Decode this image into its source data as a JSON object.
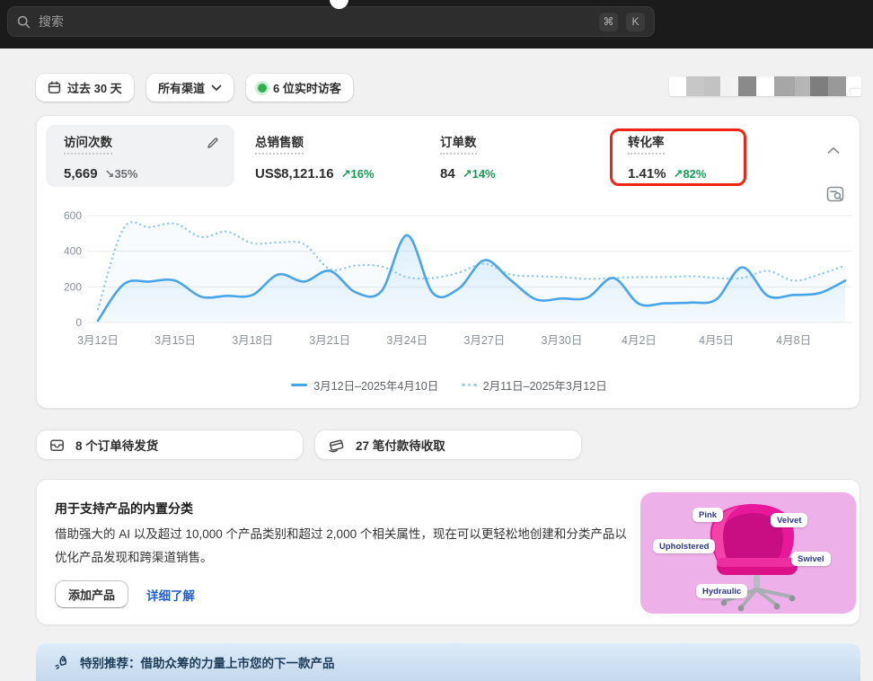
{
  "topbar": {
    "search_placeholder": "搜索",
    "shortcut_cmd": "⌘",
    "shortcut_k": "K"
  },
  "filters": {
    "date_range": "过去 30 天",
    "channel": "所有渠道",
    "live_visitors": "6 位实时访客"
  },
  "metrics": [
    {
      "label": "访问次数",
      "value": "5,669",
      "arrow": "↘",
      "delta": "35%"
    },
    {
      "label": "总销售额",
      "value": "US$8,121.16",
      "arrow": "↗",
      "delta": "16%"
    },
    {
      "label": "订单数",
      "value": "84",
      "arrow": "↗",
      "delta": "14%"
    },
    {
      "label": "转化率",
      "value": "1.41%",
      "arrow": "↗",
      "delta": "82%"
    }
  ],
  "chart_data": {
    "type": "line",
    "title": "",
    "xlabel": "",
    "ylabel": "",
    "ylim": [
      0,
      600
    ],
    "yticks": [
      0,
      200,
      400,
      600
    ],
    "grid": true,
    "legend_position": "bottom",
    "xticklabels": [
      "3月12日",
      "3月15日",
      "3月18日",
      "3月21日",
      "3月24日",
      "3月27日",
      "3月30日",
      "4月2日",
      "4月5日",
      "4月8日"
    ],
    "tick_day_indices": [
      0,
      3,
      6,
      9,
      12,
      15,
      18,
      21,
      24,
      27
    ],
    "series": [
      {
        "name": "3月12日–2025年4月10日",
        "style": "solid",
        "color": "#49a5ea",
        "values": [
          10,
          215,
          230,
          235,
          145,
          150,
          155,
          270,
          230,
          290,
          170,
          175,
          490,
          165,
          190,
          350,
          240,
          130,
          135,
          140,
          250,
          105,
          108,
          112,
          130,
          310,
          150,
          155,
          165,
          235
        ]
      },
      {
        "name": "2月11日–2025年3月12日",
        "style": "dotted",
        "color": "#90c8f2",
        "values": [
          75,
          530,
          535,
          555,
          480,
          510,
          445,
          450,
          440,
          300,
          320,
          315,
          255,
          250,
          280,
          330,
          270,
          260,
          255,
          245,
          250,
          255,
          255,
          260,
          250,
          250,
          290,
          235,
          270,
          320
        ]
      }
    ]
  },
  "notifications": [
    {
      "label": "8 个订单待发货"
    },
    {
      "label": "27 笔付款待收取"
    }
  ],
  "promo": {
    "title": "用于支持产品的内置分类",
    "body": "借助强大的 AI 以及超过 10,000 个产品类别和超过 2,000 个相关属性，现在可以更轻松地创建和分类产品以优化产品发现和跨渠道销售。",
    "primary_button": "添加产品",
    "link": "详细了解",
    "image_tags": [
      "Pink",
      "Velvet",
      "Upholstered",
      "Swivel",
      "Hydraulic"
    ]
  },
  "banner": {
    "text": "特别推荐：借助众筹的力量上市您的下一款产品"
  },
  "colors": {
    "accent_blue": "#49a5ea",
    "comparison_blue": "#90c8f2",
    "success_green": "#149a53",
    "annotation_red": "#ee2415",
    "promo_pink": "#eeb0e8",
    "chair_pink": "#e8189a"
  }
}
